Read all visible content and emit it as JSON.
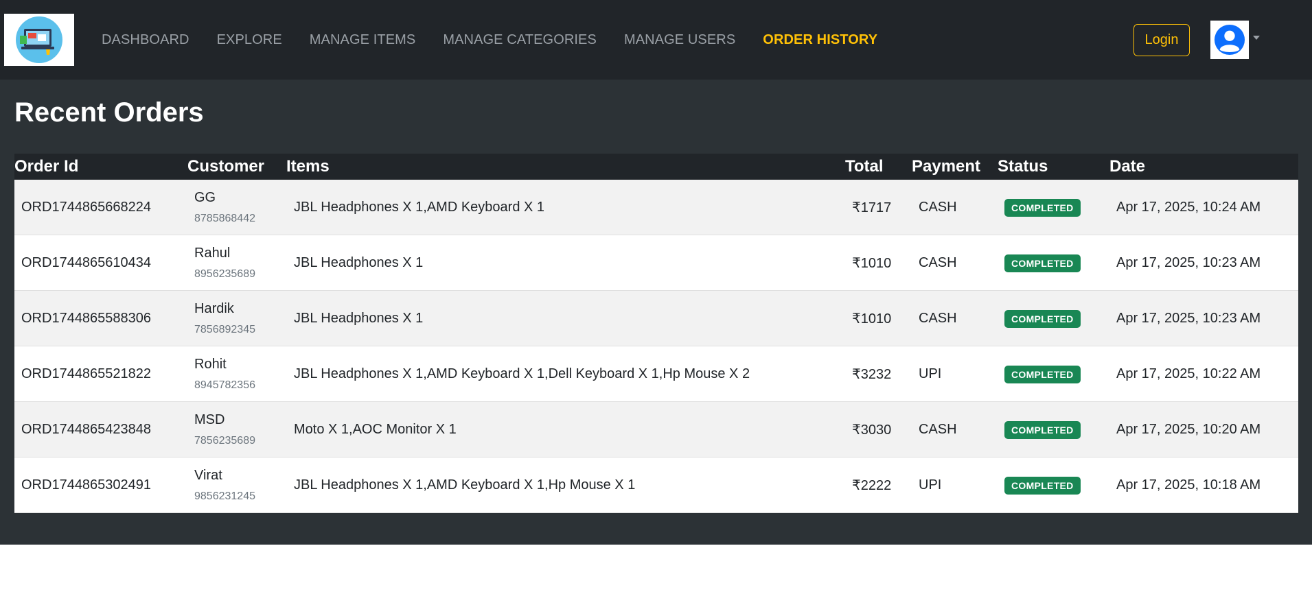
{
  "nav": {
    "links": [
      {
        "label": "DASHBOARD",
        "active": false
      },
      {
        "label": "EXPLORE",
        "active": false
      },
      {
        "label": "MANAGE ITEMS",
        "active": false
      },
      {
        "label": "MANAGE CATEGORIES",
        "active": false
      },
      {
        "label": "MANAGE USERS",
        "active": false
      },
      {
        "label": "ORDER HISTORY",
        "active": true
      }
    ],
    "login_label": "Login",
    "accent_color": "#ffc107",
    "logo_icon": "laptop-shop-logo",
    "avatar_icon": "user-avatar-icon"
  },
  "page": {
    "title": "Recent Orders"
  },
  "table": {
    "headers": {
      "order_id": "Order Id",
      "customer": "Customer",
      "items": "Items",
      "total": "Total",
      "payment": "Payment",
      "status": "Status",
      "date": "Date"
    },
    "rows": [
      {
        "order_id": "ORD1744865668224",
        "customer_name": "GG",
        "customer_phone": "8785868442",
        "items": "JBL Headphones X 1,AMD Keyboard X 1",
        "total": "₹1717",
        "payment": "CASH",
        "status": "COMPLETED",
        "date": "Apr 17, 2025, 10:24 AM"
      },
      {
        "order_id": "ORD1744865610434",
        "customer_name": "Rahul",
        "customer_phone": "8956235689",
        "items": "JBL Headphones X 1",
        "total": "₹1010",
        "payment": "CASH",
        "status": "COMPLETED",
        "date": "Apr 17, 2025, 10:23 AM"
      },
      {
        "order_id": "ORD1744865588306",
        "customer_name": "Hardik",
        "customer_phone": "7856892345",
        "items": "JBL Headphones X 1",
        "total": "₹1010",
        "payment": "CASH",
        "status": "COMPLETED",
        "date": "Apr 17, 2025, 10:23 AM"
      },
      {
        "order_id": "ORD1744865521822",
        "customer_name": "Rohit",
        "customer_phone": "8945782356",
        "items": "JBL Headphones X 1,AMD Keyboard X 1,Dell Keyboard X 1,Hp Mouse X 2",
        "total": "₹3232",
        "payment": "UPI",
        "status": "COMPLETED",
        "date": "Apr 17, 2025, 10:22 AM"
      },
      {
        "order_id": "ORD1744865423848",
        "customer_name": "MSD",
        "customer_phone": "7856235689",
        "items": "Moto X 1,AOC Monitor X 1",
        "total": "₹3030",
        "payment": "CASH",
        "status": "COMPLETED",
        "date": "Apr 17, 2025, 10:20 AM"
      },
      {
        "order_id": "ORD1744865302491",
        "customer_name": "Virat",
        "customer_phone": "9856231245",
        "items": "JBL Headphones X 1,AMD Keyboard X 1,Hp Mouse X 1",
        "total": "₹2222",
        "payment": "UPI",
        "status": "COMPLETED",
        "date": "Apr 17, 2025, 10:18 AM"
      }
    ],
    "status_color": "#198754"
  }
}
